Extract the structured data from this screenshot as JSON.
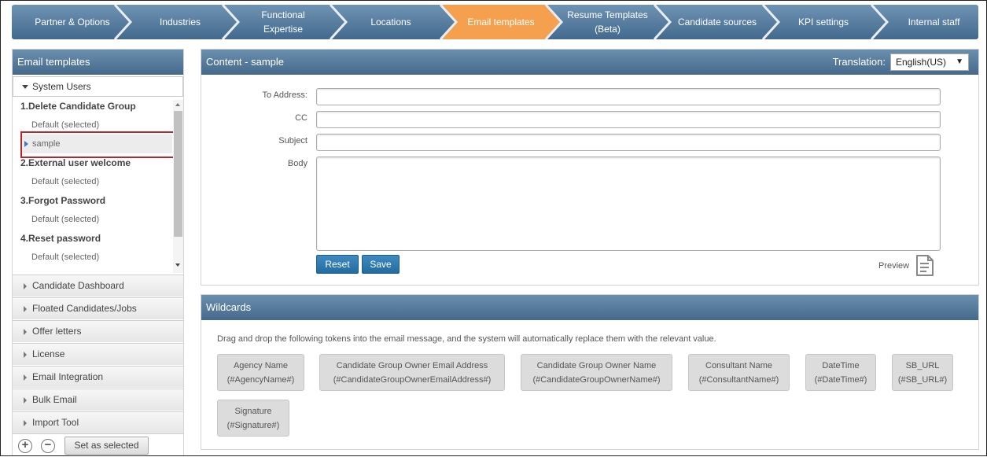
{
  "nav": {
    "tabs": [
      {
        "label": "Partner & Options"
      },
      {
        "label": "Industries"
      },
      {
        "label": "Functional\nExpertise"
      },
      {
        "label": "Locations"
      },
      {
        "label": "Email templates"
      },
      {
        "label": "Resume Templates\n(Beta)"
      },
      {
        "label": "Candidate sources"
      },
      {
        "label": "KPI settings"
      },
      {
        "label": "Internal staff"
      }
    ],
    "active_index": 4,
    "colors": {
      "bar": "#4f7497",
      "active": "#f7a04a"
    }
  },
  "left_panel": {
    "title": "Email templates",
    "section": "System Users",
    "tree": [
      {
        "label": "1.Delete Candidate Group",
        "kind": "group"
      },
      {
        "label": "Default  (selected)",
        "kind": "sub"
      },
      {
        "label": "sample",
        "kind": "sub",
        "current": true
      },
      {
        "label": "2.External user welcome",
        "kind": "group"
      },
      {
        "label": "Default  (selected)",
        "kind": "sub"
      },
      {
        "label": "3.Forgot Password",
        "kind": "group"
      },
      {
        "label": "Default  (selected)",
        "kind": "sub"
      },
      {
        "label": "4.Reset password",
        "kind": "group"
      },
      {
        "label": "Default  (selected)",
        "kind": "sub"
      }
    ],
    "accordion": [
      {
        "label": "Candidate Dashboard"
      },
      {
        "label": "Floated Candidates/Jobs"
      },
      {
        "label": "Offer letters"
      },
      {
        "label": "License"
      },
      {
        "label": "Email Integration"
      },
      {
        "label": "Bulk Email"
      },
      {
        "label": "Import Tool"
      }
    ],
    "add_icon": "+",
    "remove_icon": "−",
    "set_selected_label": "Set as selected"
  },
  "content": {
    "title": "Content - sample",
    "translation_label": "Translation:",
    "translation_value": "English(US)",
    "fields": {
      "to_label": "To Address:",
      "cc_label": "CC",
      "subject_label": "Subject",
      "body_label": "Body"
    },
    "reset_label": "Reset",
    "save_label": "Save",
    "preview_label": "Preview"
  },
  "wildcards": {
    "title": "Wildcards",
    "description": "Drag and drop the following tokens into the email message, and the system will automatically replace them with the relevant value.",
    "tokens": [
      {
        "name": "Agency Name",
        "token": "(#AgencyName#)"
      },
      {
        "name": "Candidate Group Owner Email Address",
        "token": "(#CandidateGroupOwnerEmailAddress#)"
      },
      {
        "name": "Candidate Group Owner Name",
        "token": "(#CandidateGroupOwnerName#)"
      },
      {
        "name": "Consultant Name",
        "token": "(#ConsultantName#)"
      },
      {
        "name": "DateTime",
        "token": "(#DateTime#)"
      },
      {
        "name": "SB_URL",
        "token": "(#SB_URL#)"
      },
      {
        "name": "Signature",
        "token": "(#Signature#)"
      }
    ]
  }
}
